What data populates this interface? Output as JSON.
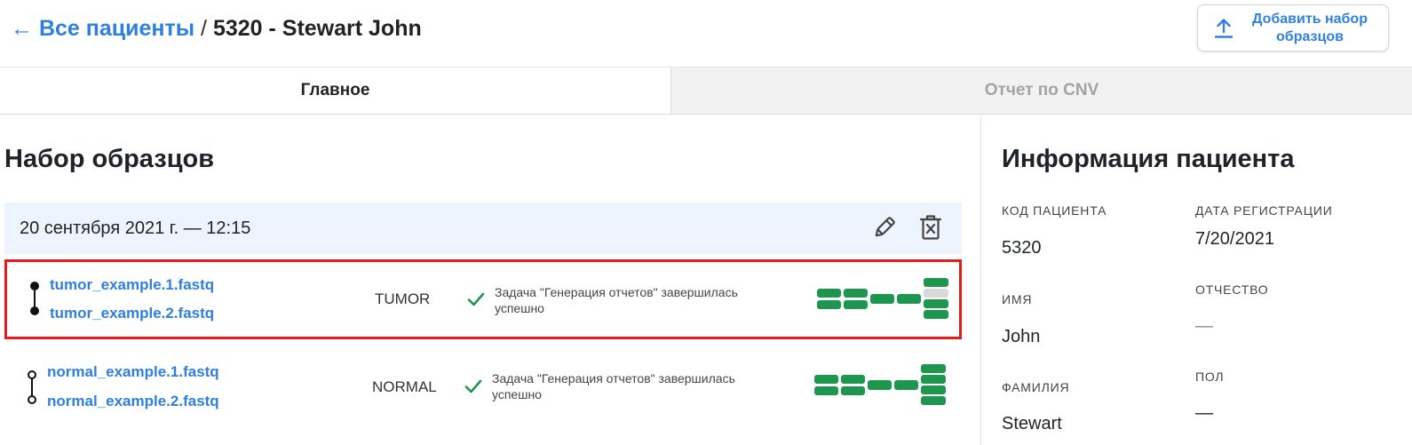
{
  "header": {
    "back_link": "← Все пациенты",
    "separator": " / ",
    "current": "5320 - Stewart John",
    "add_button_label": "Добавить набор образцов"
  },
  "tabs": [
    {
      "label": "Главное",
      "active": true
    },
    {
      "label": "Отчет по CNV",
      "active": false
    }
  ],
  "sample_sets": {
    "title": "Набор образцов",
    "set": {
      "date": "20 сентября 2021 г. — 12:15",
      "icons": [
        "edit-icon",
        "delete-icon"
      ],
      "samples": [
        {
          "files": [
            "tumor_example.1.fastq",
            "tumor_example.2.fastq"
          ],
          "type": "TUMOR",
          "status": "Задача \"Генерация отчетов\" завершилась успешно",
          "status_icon": "check-icon",
          "highlighted": true,
          "markers": "filled",
          "pipeline_progress": {
            "completed": 9,
            "total": 10
          }
        },
        {
          "files": [
            "normal_example.1.fastq",
            "normal_example.2.fastq"
          ],
          "type": "NORMAL",
          "status": "Задача \"Генерация отчетов\" завершилась успешно",
          "status_icon": "check-icon",
          "highlighted": false,
          "markers": "hollow",
          "pipeline_progress": {
            "completed": 10,
            "total": 10
          }
        }
      ]
    }
  },
  "patient_info": {
    "title": "Информация пациента",
    "fields": {
      "code": {
        "label": "КОД ПАЦИЕНТА",
        "value": "5320"
      },
      "reg_date": {
        "label": "ДАТА РЕГИСТРАЦИИ",
        "value": "7/20/2021"
      },
      "first_name": {
        "label": "ИМЯ",
        "value": "John"
      },
      "patronymic": {
        "label": "ОТЧЕСТВО",
        "value": "—"
      },
      "last_name": {
        "label": "ФАМИЛИЯ",
        "value": "Stewart"
      },
      "sex": {
        "label": "ПОЛ",
        "value": "—"
      }
    }
  },
  "colors": {
    "accent": "#2f7fe0",
    "success": "#1e9650",
    "highlight_border": "#e81b1b",
    "set_header_bg": "#eef4fd",
    "pending": "#d9d9d9"
  }
}
